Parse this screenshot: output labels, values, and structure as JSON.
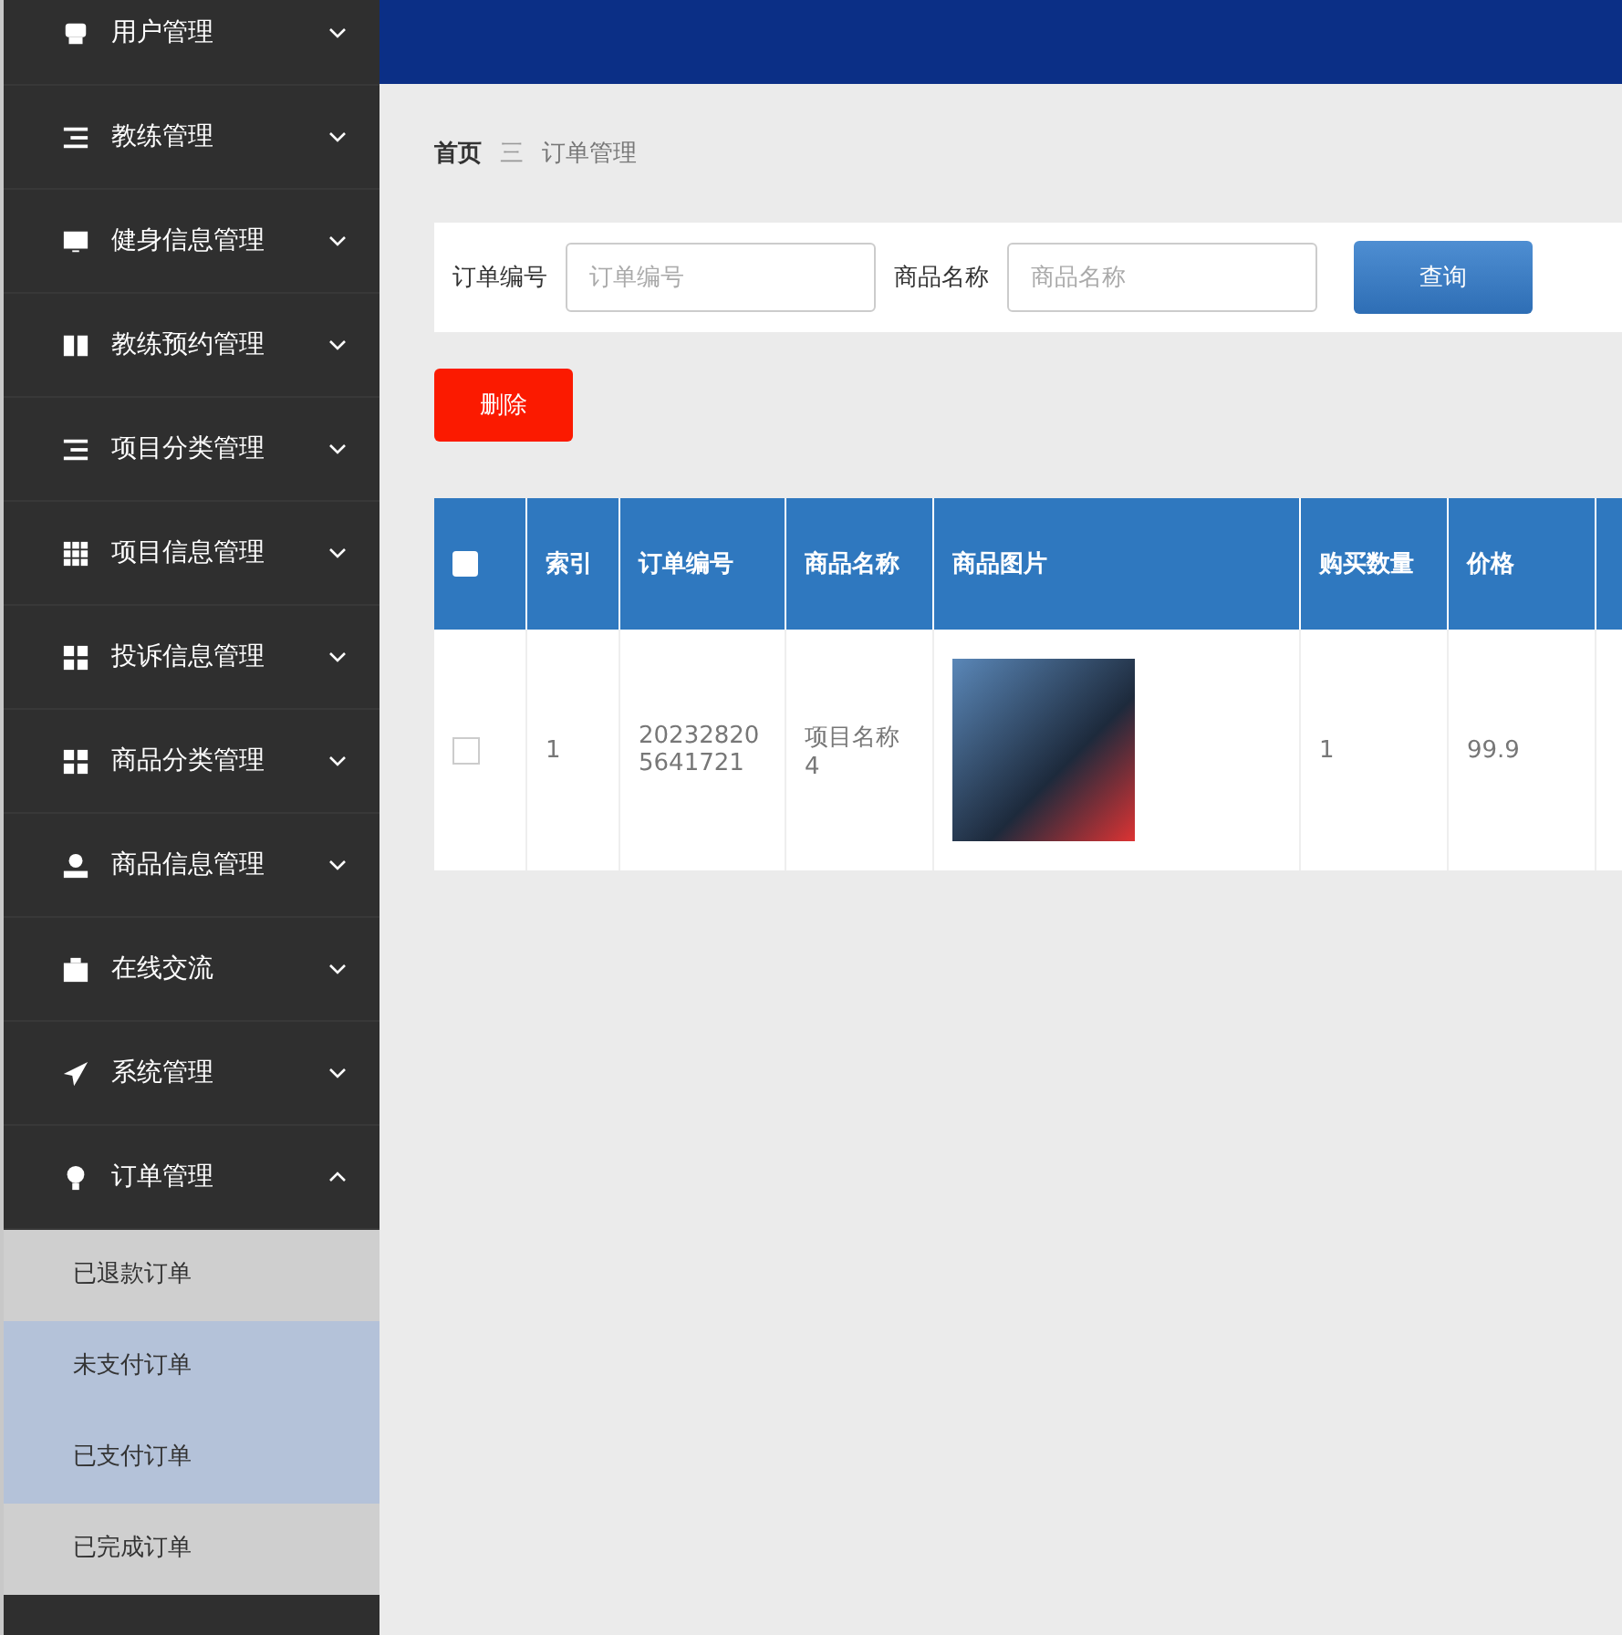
{
  "sidebar": {
    "items": [
      {
        "label": "用户管理",
        "expanded": false
      },
      {
        "label": "教练管理",
        "expanded": false
      },
      {
        "label": "健身信息管理",
        "expanded": false
      },
      {
        "label": "教练预约管理",
        "expanded": false
      },
      {
        "label": "项目分类管理",
        "expanded": false
      },
      {
        "label": "项目信息管理",
        "expanded": false
      },
      {
        "label": "投诉信息管理",
        "expanded": false
      },
      {
        "label": "商品分类管理",
        "expanded": false
      },
      {
        "label": "商品信息管理",
        "expanded": false
      },
      {
        "label": "在线交流",
        "expanded": false
      },
      {
        "label": "系统管理",
        "expanded": false
      },
      {
        "label": "订单管理",
        "expanded": true,
        "children": [
          {
            "label": "已退款订单",
            "selected": false
          },
          {
            "label": "未支付订单",
            "selected": true
          },
          {
            "label": "已支付订单",
            "selected": true
          },
          {
            "label": "已完成订单",
            "selected": false
          }
        ]
      }
    ]
  },
  "breadcrumb": [
    "首页",
    "三",
    "订单管理"
  ],
  "search": {
    "fields": [
      {
        "label": "订单编号",
        "placeholder": "订单编号"
      },
      {
        "label": "商品名称",
        "placeholder": "商品名称"
      }
    ],
    "button": "查询"
  },
  "delete_button": "删除",
  "table": {
    "select_all_checked": false,
    "columns": [
      "索引",
      "订单编号",
      "商品名称",
      "商品图片",
      "购买数量",
      "价格"
    ],
    "rows": [
      {
        "checked": false,
        "cells": [
          "1",
          "20232820 5641721",
          "项目名称4",
          "",
          "1",
          "99.9"
        ]
      }
    ]
  }
}
